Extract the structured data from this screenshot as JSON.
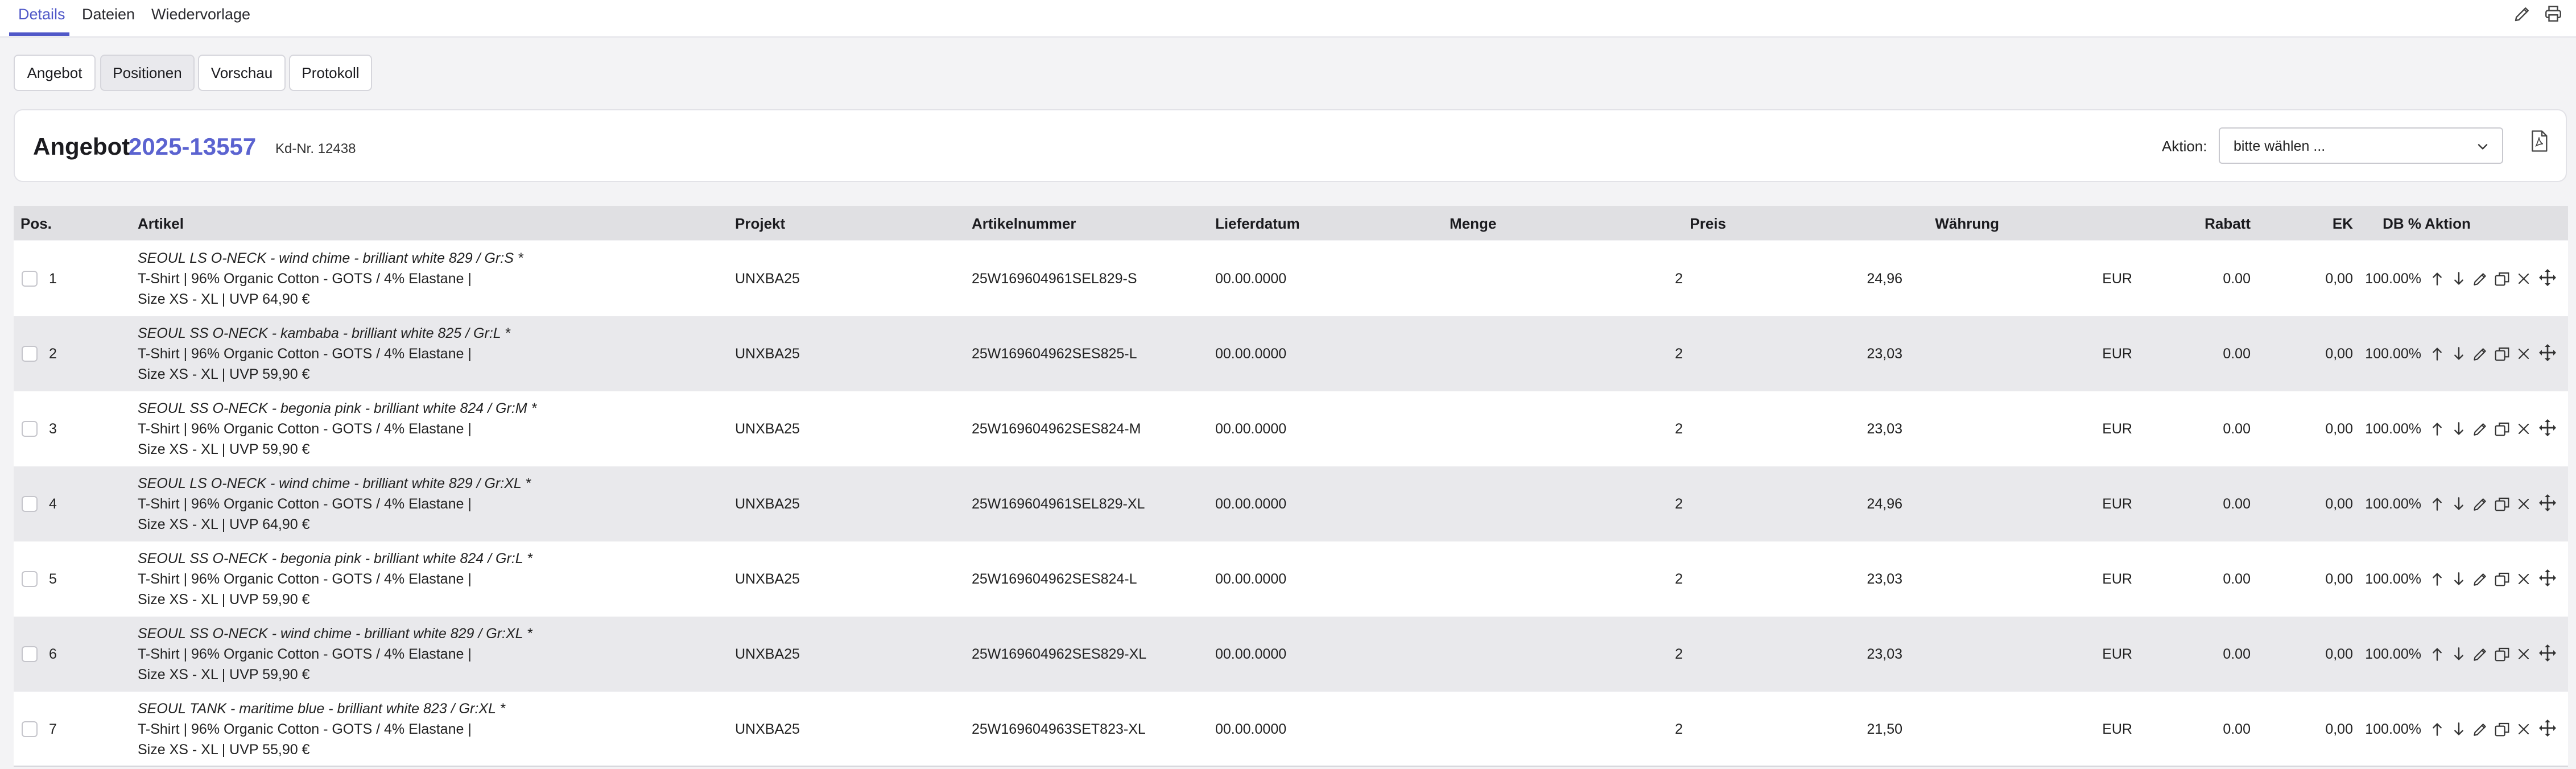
{
  "tabs": [
    {
      "label": "Details",
      "active": true
    },
    {
      "label": "Dateien",
      "active": false
    },
    {
      "label": "Wiedervorlage",
      "active": false
    }
  ],
  "top_icons": [
    "pencil-icon",
    "printer-icon"
  ],
  "subtabs": [
    {
      "label": "Angebot",
      "active": false
    },
    {
      "label": "Positionen",
      "active": true
    },
    {
      "label": "Vorschau",
      "active": false
    },
    {
      "label": "Protokoll",
      "active": false
    }
  ],
  "header": {
    "title": "Angebot",
    "number": "2025-13557",
    "customer_no": "Kd-Nr. 12438",
    "action_label": "Aktion:",
    "action_select": "bitte wählen ...",
    "pdf_icon": "pdf-document-icon"
  },
  "table": {
    "columns": [
      "Pos.",
      "Artikel",
      "Projekt",
      "Artikelnummer",
      "Lieferdatum",
      "Menge",
      "Preis",
      "Währung",
      "Rabatt",
      "EK",
      "DB %",
      "Aktion"
    ],
    "rows": [
      {
        "pos": "1",
        "art1": "SEOUL LS O-NECK - wind chime - brilliant white 829 / Gr:S *",
        "art2": "T-Shirt | 96% Organic Cotton - GOTS / 4% Elastane |",
        "art3": "Size XS - XL | UVP 64,90 €",
        "projekt": "UNXBA25",
        "artnr": "25W169604961SEL829-S",
        "liefer": "00.00.0000",
        "menge": "2",
        "preis": "24,96",
        "waehrung": "EUR",
        "rabatt": "0.00",
        "ek": "0,00",
        "db": "100.00%"
      },
      {
        "pos": "2",
        "art1": "SEOUL SS O-NECK - kambaba - brilliant white 825 / Gr:L *",
        "art2": "T-Shirt | 96% Organic Cotton - GOTS / 4% Elastane |",
        "art3": "Size XS - XL | UVP 59,90 €",
        "projekt": "UNXBA25",
        "artnr": "25W169604962SES825-L",
        "liefer": "00.00.0000",
        "menge": "2",
        "preis": "23,03",
        "waehrung": "EUR",
        "rabatt": "0.00",
        "ek": "0,00",
        "db": "100.00%"
      },
      {
        "pos": "3",
        "art1": "SEOUL SS O-NECK - begonia pink - brilliant white 824 / Gr:M *",
        "art2": "T-Shirt | 96% Organic Cotton - GOTS / 4% Elastane |",
        "art3": "Size XS - XL | UVP 59,90 €",
        "projekt": "UNXBA25",
        "artnr": "25W169604962SES824-M",
        "liefer": "00.00.0000",
        "menge": "2",
        "preis": "23,03",
        "waehrung": "EUR",
        "rabatt": "0.00",
        "ek": "0,00",
        "db": "100.00%"
      },
      {
        "pos": "4",
        "art1": "SEOUL LS O-NECK - wind chime - brilliant white 829 / Gr:XL *",
        "art2": "T-Shirt | 96% Organic Cotton - GOTS / 4% Elastane |",
        "art3": "Size XS - XL | UVP 64,90 €",
        "projekt": "UNXBA25",
        "artnr": "25W169604961SEL829-XL",
        "liefer": "00.00.0000",
        "menge": "2",
        "preis": "24,96",
        "waehrung": "EUR",
        "rabatt": "0.00",
        "ek": "0,00",
        "db": "100.00%"
      },
      {
        "pos": "5",
        "art1": "SEOUL SS O-NECK - begonia pink - brilliant white 824 / Gr:L *",
        "art2": "T-Shirt | 96% Organic Cotton - GOTS / 4% Elastane |",
        "art3": "Size XS - XL | UVP 59,90 €",
        "projekt": "UNXBA25",
        "artnr": "25W169604962SES824-L",
        "liefer": "00.00.0000",
        "menge": "2",
        "preis": "23,03",
        "waehrung": "EUR",
        "rabatt": "0.00",
        "ek": "0,00",
        "db": "100.00%"
      },
      {
        "pos": "6",
        "art1": "SEOUL SS O-NECK - wind chime - brilliant white 829 / Gr:XL *",
        "art2": "T-Shirt | 96% Organic Cotton - GOTS / 4% Elastane |",
        "art3": "Size XS - XL | UVP 59,90 €",
        "projekt": "UNXBA25",
        "artnr": "25W169604962SES829-XL",
        "liefer": "00.00.0000",
        "menge": "2",
        "preis": "23,03",
        "waehrung": "EUR",
        "rabatt": "0.00",
        "ek": "0,00",
        "db": "100.00%"
      },
      {
        "pos": "7",
        "art1": "SEOUL TANK - maritime blue - brilliant white 823 / Gr:XL *",
        "art2": "T-Shirt | 96% Organic Cotton - GOTS / 4% Elastane |",
        "art3": "Size XS - XL | UVP 55,90 €",
        "projekt": "UNXBA25",
        "artnr": "25W169604963SET823-XL",
        "liefer": "00.00.0000",
        "menge": "2",
        "preis": "21,50",
        "waehrung": "EUR",
        "rabatt": "0.00",
        "ek": "0,00",
        "db": "100.00%"
      }
    ],
    "row_actions": [
      "arrow-up-icon",
      "arrow-down-icon",
      "pencil-icon",
      "copy-icon",
      "close-icon",
      "move-icon"
    ]
  },
  "colors": {
    "accent": "#5058c8",
    "number": "#5b63d0"
  }
}
